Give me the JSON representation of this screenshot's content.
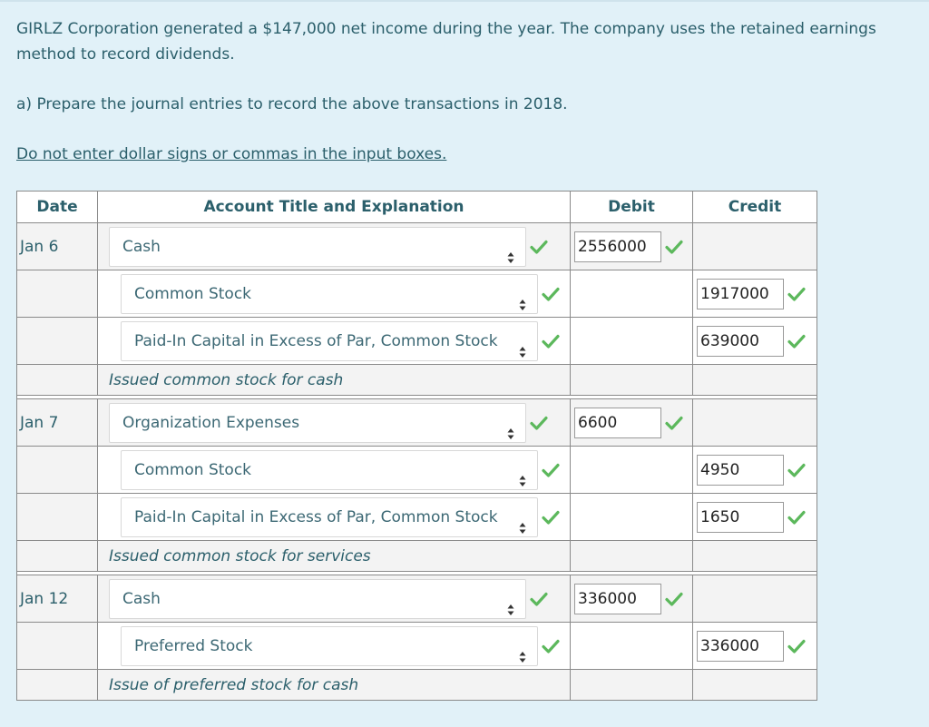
{
  "question": {
    "intro": "GIRLZ Corporation generated a $147,000 net income during the year. The company uses the retained earnings method to record dividends.",
    "part_a": "a) Prepare the journal entries to record the above transactions in 2018.",
    "note": "Do not enter dollar signs or commas in the input boxes."
  },
  "table": {
    "headers": {
      "date": "Date",
      "account": "Account Title and Explanation",
      "debit": "Debit",
      "credit": "Credit"
    },
    "entries": [
      {
        "date": "Jan 6",
        "lines": [
          {
            "account": "Cash",
            "side": "debit",
            "amount": "2556000"
          },
          {
            "account": "Common Stock",
            "side": "credit",
            "amount": "1917000"
          },
          {
            "account": "Paid-In Capital in Excess of Par, Common Stock",
            "side": "credit",
            "amount": "639000"
          }
        ],
        "explanation": "Issued common stock for cash"
      },
      {
        "date": "Jan 7",
        "lines": [
          {
            "account": "Organization Expenses",
            "side": "debit",
            "amount": "6600"
          },
          {
            "account": "Common Stock",
            "side": "credit",
            "amount": "4950"
          },
          {
            "account": "Paid-In Capital in Excess of Par, Common Stock",
            "side": "credit",
            "amount": "1650"
          }
        ],
        "explanation": "Issued common stock for services"
      },
      {
        "date": "Jan 12",
        "lines": [
          {
            "account": "Cash",
            "side": "debit",
            "amount": "336000"
          },
          {
            "account": "Preferred Stock",
            "side": "credit",
            "amount": "336000"
          }
        ],
        "explanation": "Issue of preferred stock for cash"
      }
    ]
  },
  "colors": {
    "check": "#5cb85c",
    "text": "#2b5f6b",
    "background": "#e1f1f8"
  },
  "icons": {
    "select_arrow": "up-down-chevron-icon",
    "correct": "check-icon"
  }
}
